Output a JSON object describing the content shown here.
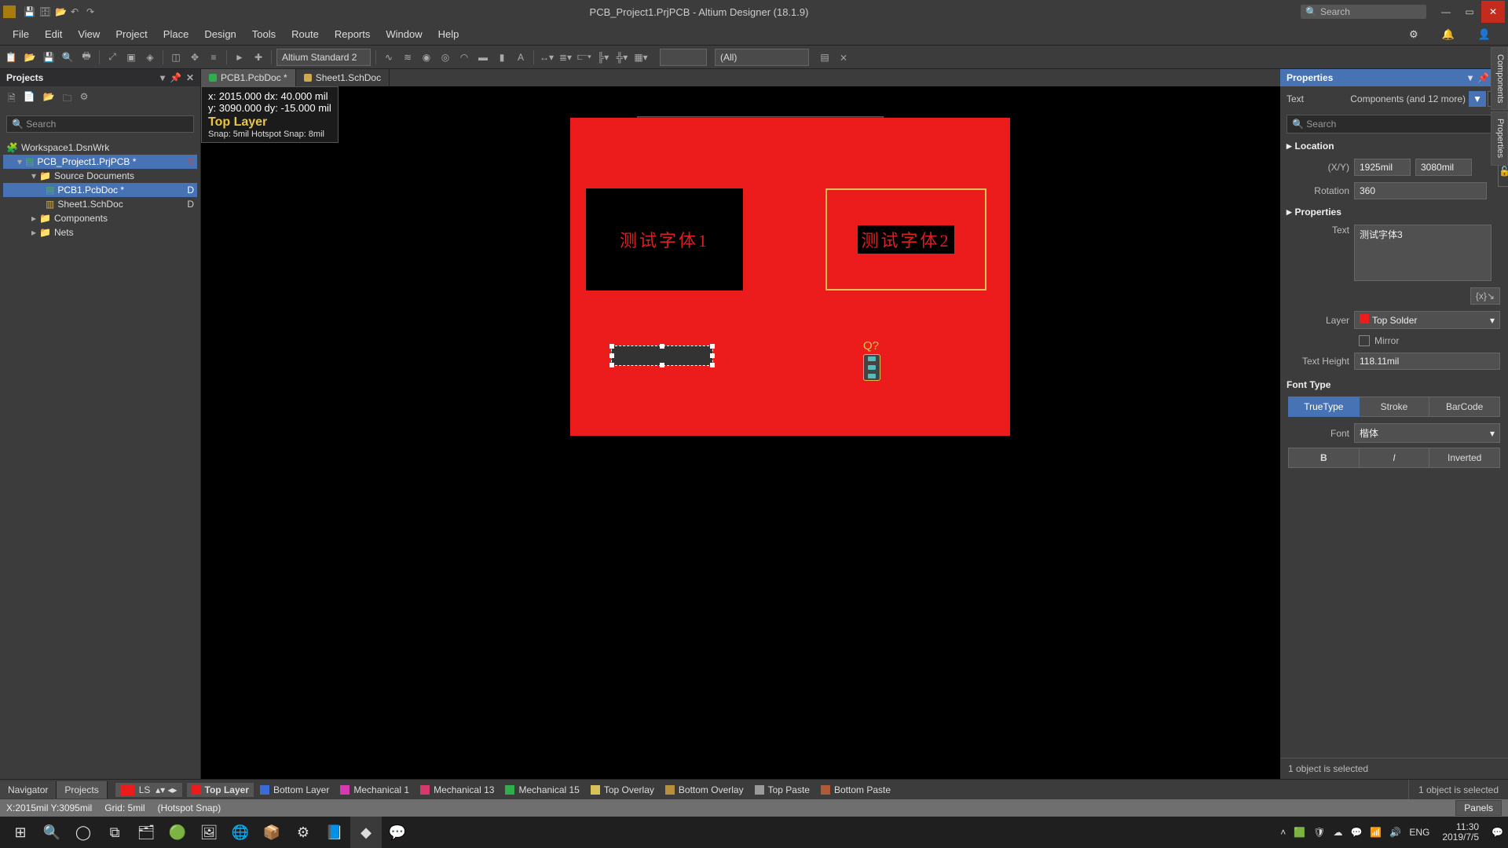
{
  "titlebar": {
    "title": "PCB_Project1.PrjPCB - Altium Designer (18.1.9)",
    "search_placeholder": "Search"
  },
  "menu": {
    "items": [
      "File",
      "Edit",
      "View",
      "Project",
      "Place",
      "Design",
      "Tools",
      "Route",
      "Reports",
      "Window",
      "Help"
    ]
  },
  "toolbar": {
    "dropdown1": "Altium Standard 2",
    "dropdown2": "(All)"
  },
  "projects_panel": {
    "title": "Projects",
    "search_placeholder": "Search",
    "workspace": "Workspace1.DsnWrk",
    "project": "PCB_Project1.PrjPCB *",
    "src_folder": "Source Documents",
    "doc1": "PCB1.PcbDoc *",
    "doc2": "Sheet1.SchDoc",
    "comp_folder": "Components",
    "nets_folder": "Nets",
    "badge_d": "D"
  },
  "doctabs": {
    "tab1": "PCB1.PcbDoc *",
    "tab2": "Sheet1.SchDoc"
  },
  "coord": {
    "xy": "x: 2015.000  dx:   40.000 mil",
    "xy2": "y: 3090.000  dy:  -15.000 mil",
    "layer": "Top Layer",
    "snap": "Snap: 5mil Hotspot Snap: 8mil"
  },
  "board": {
    "text1": "测试字体1",
    "text2": "测试字体2",
    "refdes": "Q?"
  },
  "right_tabs": {
    "t1": "Components",
    "t2": "Properties"
  },
  "props": {
    "title": "Properties",
    "object_type": "Text",
    "filter_label": "Components (and 12 more)",
    "search_placeholder": "Search",
    "sec_location": "Location",
    "xy_label": "(X/Y)",
    "x": "1925mil",
    "y": "3080mil",
    "rotation_label": "Rotation",
    "rotation": "360",
    "sec_props": "Properties",
    "text_label": "Text",
    "text_value": "测试字体3",
    "layer_label": "Layer",
    "layer_value": "Top Solder",
    "mirror_label": "Mirror",
    "height_label": "Text Height",
    "height_value": "118.11mil",
    "font_type_label": "Font Type",
    "ft1": "TrueType",
    "ft2": "Stroke",
    "ft3": "BarCode",
    "font_label": "Font",
    "font_value": "楷体",
    "bold": "B",
    "italic": "I",
    "inverted": "Inverted",
    "selection_line": "1 object is selected"
  },
  "bottom": {
    "navigator": "Navigator",
    "projects": "Projects",
    "ls": "LS",
    "l1": {
      "name": "Top Layer",
      "c": "#ec1c1c"
    },
    "l2": {
      "name": "Bottom Layer",
      "c": "#3a6bd6"
    },
    "l3": {
      "name": "Mechanical 1",
      "c": "#d63ab3"
    },
    "l4": {
      "name": "Mechanical 13",
      "c": "#d63a6b"
    },
    "l5": {
      "name": "Mechanical 15",
      "c": "#2fae4a"
    },
    "l6": {
      "name": "Top Overlay",
      "c": "#d6c257"
    },
    "l7": {
      "name": "Bottom Overlay",
      "c": "#b88f3a"
    },
    "l8": {
      "name": "Top Paste",
      "c": "#9a9a9a"
    },
    "l9": {
      "name": "Bottom Paste",
      "c": "#b05a3a"
    }
  },
  "status": {
    "coord": "X:2015mil Y:3095mil",
    "grid": "Grid: 5mil",
    "snap": "(Hotspot Snap)",
    "panels": "Panels"
  },
  "taskbar": {
    "lang": "ENG",
    "time": "11:30",
    "date": "2019/7/5"
  }
}
